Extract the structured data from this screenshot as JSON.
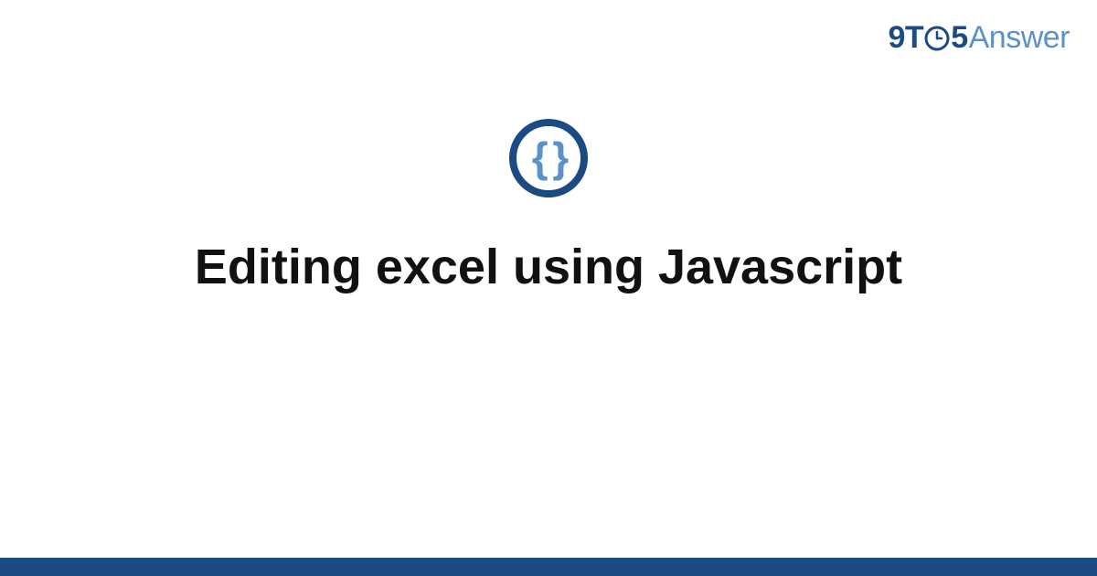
{
  "header": {
    "logo": {
      "part1": "9T",
      "part2": "5",
      "part3": "Answer"
    }
  },
  "main": {
    "icon_name": "code-braces-icon",
    "braces_glyph": "{ }",
    "title": "Editing excel using Javascript"
  },
  "colors": {
    "brand_dark": "#1b4b82",
    "brand_light": "#5992c9"
  }
}
